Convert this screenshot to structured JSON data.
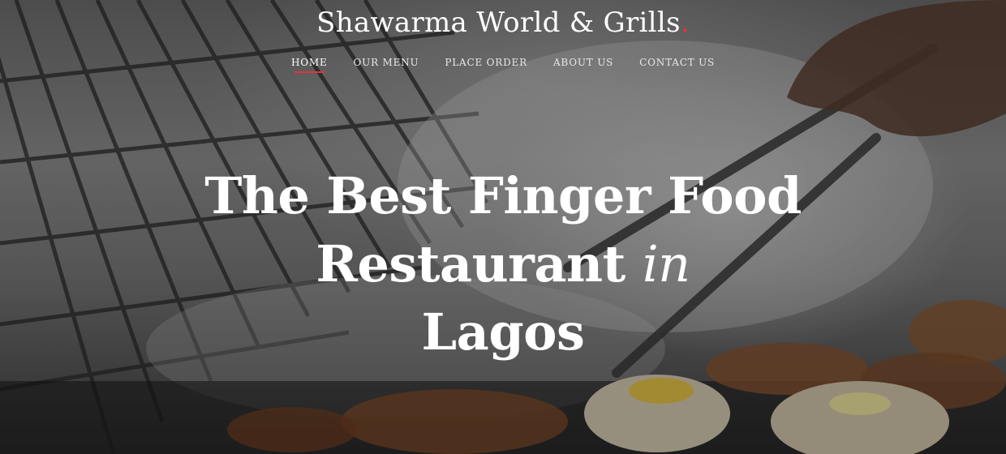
{
  "brand": {
    "name": "Shawarma World & Grills",
    "dot": ".",
    "accent_color": "#e0363d"
  },
  "nav": {
    "items": [
      {
        "label": "HOME",
        "active": true
      },
      {
        "label": "OUR MENU",
        "active": false
      },
      {
        "label": "PLACE ORDER",
        "active": false
      },
      {
        "label": "ABOUT US",
        "active": false
      },
      {
        "label": "CONTACT US",
        "active": false
      }
    ]
  },
  "hero": {
    "headline_main": "The Best Finger Food Restaurant",
    "headline_italic": "in",
    "headline_end": "Lagos"
  }
}
